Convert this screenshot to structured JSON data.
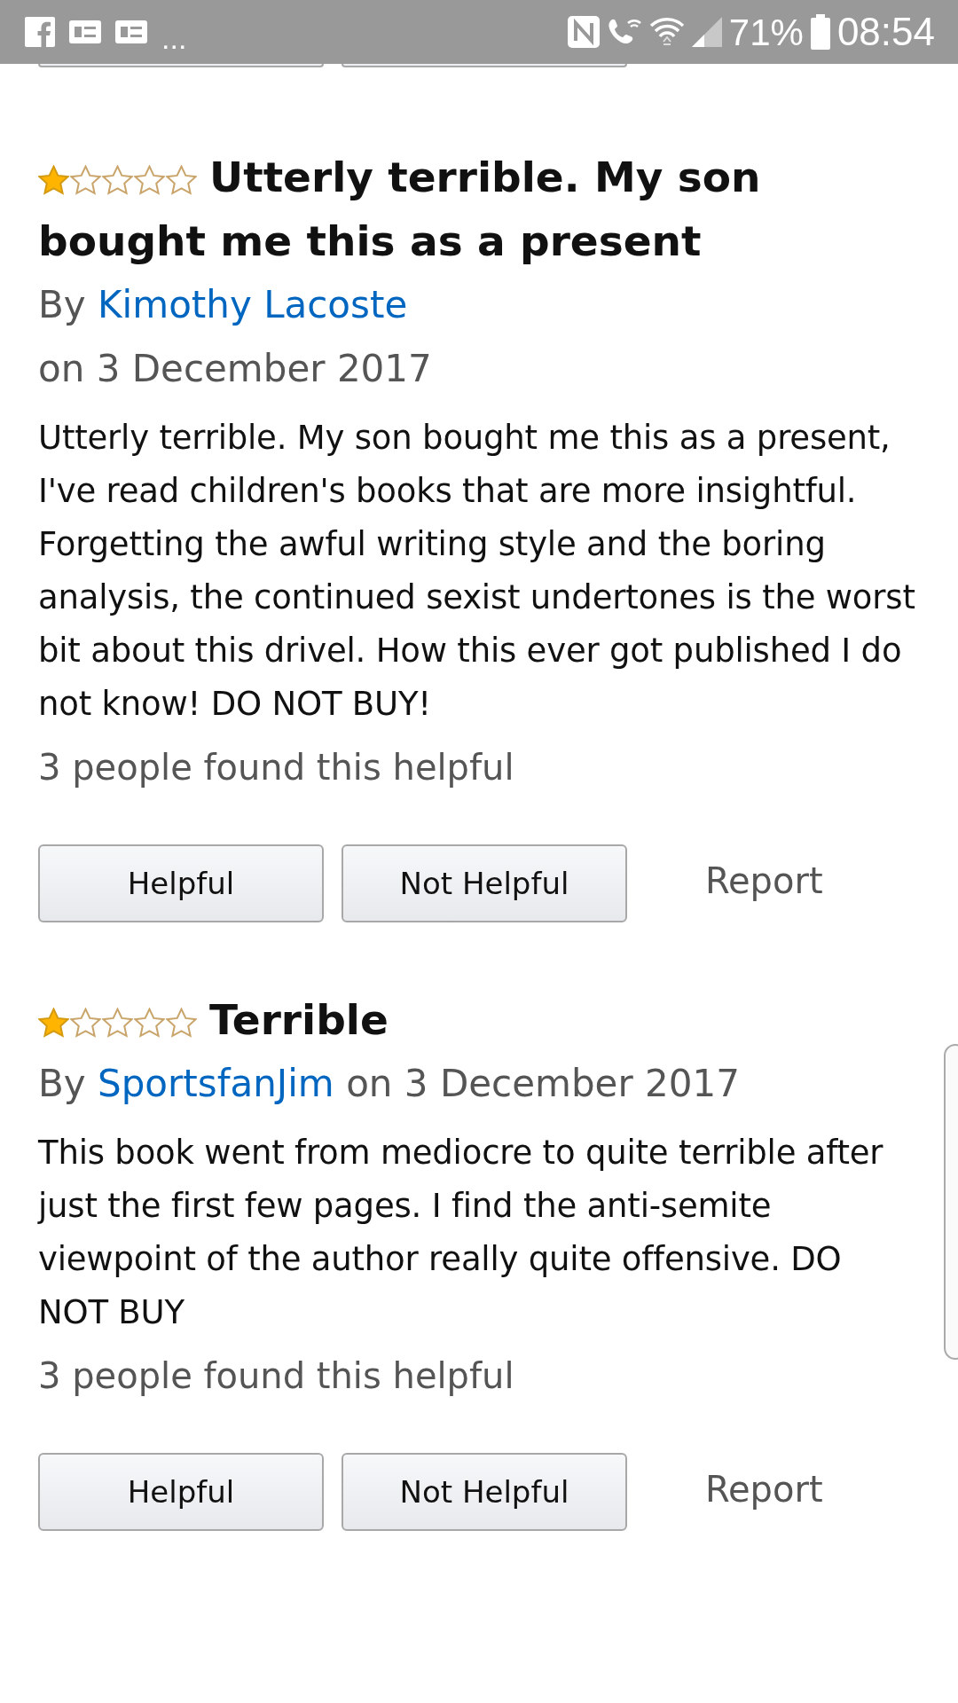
{
  "status_bar": {
    "overflow": "...",
    "battery": "71%",
    "time": "08:54"
  },
  "reviews": [
    {
      "stars": 1,
      "title": "Utterly terrible. My son bought me this as a present",
      "by": "By",
      "author": "Kimothy Lacoste",
      "date": "on 3 December 2017",
      "date_inline": false,
      "body": "Utterly terrible. My son bought me this as a present, I've read children's books that are more insightful. Forgetting the awful writing style and the boring analysis, the continued sexist undertones is the worst bit about this drivel. How this ever got published I do not know! DO NOT BUY!",
      "helpful_count": "3 people found this helpful",
      "buttons": [
        "Helpful",
        "Not Helpful"
      ],
      "report": "Report"
    },
    {
      "stars": 1,
      "title": "Terrible",
      "by": "By",
      "author": "SportsfanJim",
      "date": "on 3 December 2017",
      "date_inline": true,
      "body": "This book went from mediocre to quite terrible after just the first few pages. I find the anti-semite viewpoint of the author really quite offensive. DO NOT BUY",
      "helpful_count": "3 people found this helpful",
      "buttons": [
        "Helpful",
        "Not Helpful"
      ],
      "report": "Report"
    }
  ]
}
